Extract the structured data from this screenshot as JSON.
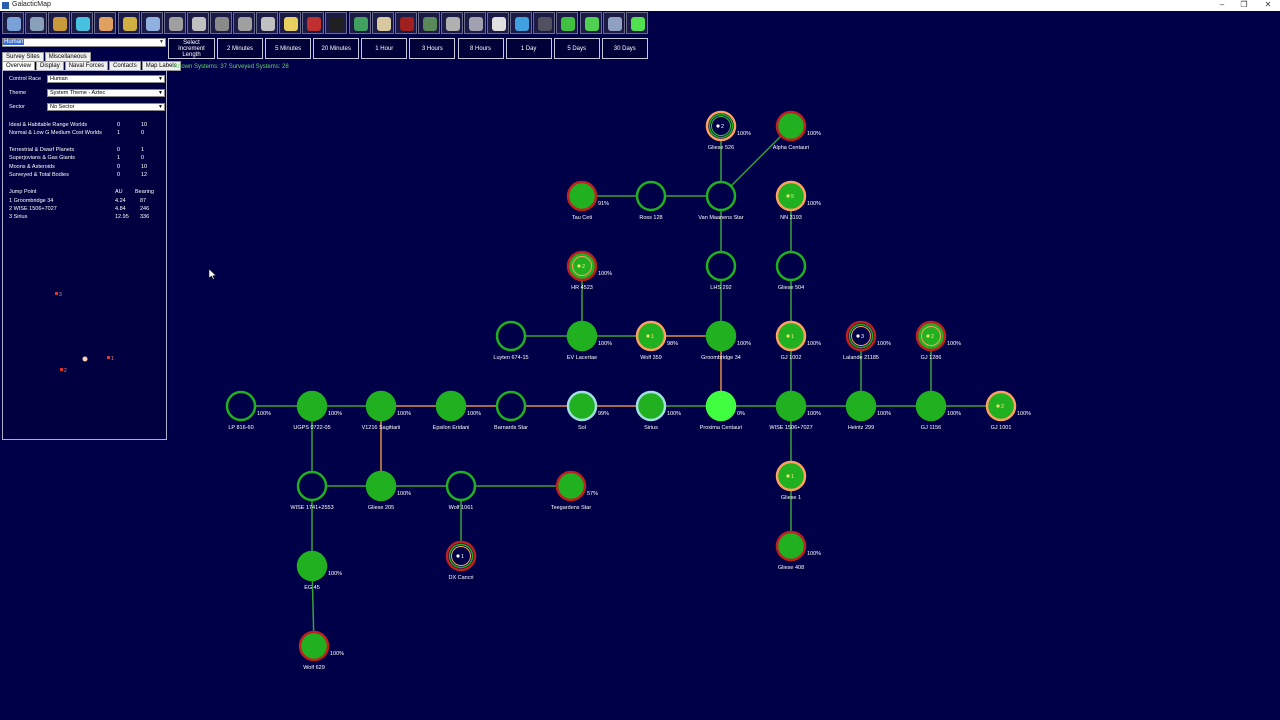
{
  "window": {
    "title": "GalacticMap",
    "minimize": "–",
    "restore": "❐",
    "close": "✕"
  },
  "toolbar": {
    "icons": [
      {
        "name": "galaxy-icon",
        "color": "#7aa0d8"
      },
      {
        "name": "planets-icon",
        "color": "#8aa0b8"
      },
      {
        "name": "treasure-chest-icon",
        "color": "#c89a3a"
      },
      {
        "name": "flask-icon",
        "color": "#48c0e0"
      },
      {
        "name": "people-icon",
        "color": "#e0a060"
      },
      {
        "name": "industry-icon",
        "color": "#d0b040"
      },
      {
        "name": "map-icon",
        "color": "#90b0e0"
      },
      {
        "name": "ship-design-icon",
        "color": "#a0a0a0"
      },
      {
        "name": "missile-icon",
        "color": "#c0c0c0"
      },
      {
        "name": "turret-icon",
        "color": "#8a8a8a"
      },
      {
        "name": "ground-forces-icon",
        "color": "#a0a0a0"
      },
      {
        "name": "commander-icon",
        "color": "#c0c0c0"
      },
      {
        "name": "star-icon",
        "color": "#e8d060"
      },
      {
        "name": "flag-icon",
        "color": "#c03030"
      },
      {
        "name": "system-view-icon",
        "color": "#202020"
      },
      {
        "name": "globe-icon",
        "color": "#40a060"
      },
      {
        "name": "skull-icon",
        "color": "#d8c8a0"
      },
      {
        "name": "alien-icon",
        "color": "#a02020"
      },
      {
        "name": "cards-icon",
        "color": "#5a8a5a"
      },
      {
        "name": "gear-icon",
        "color": "#b0b0b0"
      },
      {
        "name": "cargo-icon",
        "color": "#a0a0b0"
      },
      {
        "name": "calendar-icon",
        "color": "#e0e0e0"
      },
      {
        "name": "refresh-icon",
        "color": "#40a0e0"
      },
      {
        "name": "grid-icon",
        "color": "#505060"
      },
      {
        "name": "green-arrow-icon",
        "color": "#40c040"
      },
      {
        "name": "green-plus-icon",
        "color": "#50d050"
      },
      {
        "name": "profile-icon",
        "color": "#90a0c0"
      },
      {
        "name": "green-orb-icon",
        "color": "#50e050"
      }
    ]
  },
  "race_select": {
    "value": "Human"
  },
  "tabs_row1": [
    "Survey Sites",
    "Miscellaneous"
  ],
  "tabs_row2": [
    "Overview",
    "Display",
    "Naval Forces",
    "Contacts",
    "Map Labels"
  ],
  "overview": {
    "control_race_label": "Control Race",
    "control_race_value": "Human",
    "theme_label": "Theme",
    "theme_value": "System Theme - Aztec",
    "sector_label": "Sector",
    "sector_value": "No Sector",
    "stats": [
      {
        "label": "Ideal & Habitable Range Worlds",
        "a": "0",
        "b": "10"
      },
      {
        "label": "Normal & Low G Medium Cost Worlds",
        "a": "1",
        "b": "0"
      },
      {
        "label": "Terrestrial & Dwarf Planets",
        "a": "0",
        "b": "1"
      },
      {
        "label": "Superjovians & Gas Giants",
        "a": "1",
        "b": "0"
      },
      {
        "label": "Moons & Asteroids",
        "a": "0",
        "b": "10"
      },
      {
        "label": "Surveyed & Total Bodies",
        "a": "0",
        "b": "12"
      }
    ],
    "jump_header": {
      "label": "Jump Point",
      "au": "AU",
      "bearing": "Bearing"
    },
    "jumps": [
      {
        "label": "1  Groombridge 34",
        "au": "4.24",
        "bearing": "87"
      },
      {
        "label": "2  WISE 1506+7027",
        "au": "4.84",
        "bearing": "246"
      },
      {
        "label": "3  Sirius",
        "au": "12.95",
        "bearing": "336"
      }
    ],
    "minimap_labels": [
      "3",
      "1",
      "2"
    ]
  },
  "increments": {
    "header": [
      "Select Increment",
      "Length"
    ],
    "buttons": [
      "2 Minutes",
      "5 Minutes",
      "20 Minutes",
      "1 Hour",
      "3 Hours",
      "8 Hours",
      "1 Day",
      "5 Days",
      "30 Days"
    ]
  },
  "known_systems_text": "Known Systems: 37   Surveyed Systems: 28",
  "map": {
    "systems": [
      {
        "id": "gliese526",
        "name": "Gliese 526",
        "pct": "100%",
        "fill": "#000048",
        "ring": "#ffa060",
        "inner": "#40c040",
        "marker": "2"
      },
      {
        "id": "alphacen",
        "name": "Alpha Centauri",
        "pct": "100%",
        "fill": "#20b020",
        "ring": "#c02020",
        "inner": "",
        "marker": ""
      },
      {
        "id": "tauceti",
        "name": "Tau Ceti",
        "pct": "91%",
        "fill": "#20b020",
        "ring": "#c02020",
        "inner": "",
        "marker": ""
      },
      {
        "id": "ross128",
        "name": "Ross 128",
        "pct": "",
        "fill": "#000048",
        "ring": "#20b020",
        "inner": "",
        "marker": ""
      },
      {
        "id": "vanmaanen",
        "name": "Van Maanens Star",
        "pct": "",
        "fill": "#000048",
        "ring": "#20b020",
        "inner": "",
        "marker": ""
      },
      {
        "id": "nn3193",
        "name": "NN 3193",
        "pct": "100%",
        "fill": "#20b020",
        "ring": "#ffa060",
        "inner": "",
        "marker": "5"
      },
      {
        "id": "hr4523",
        "name": "HR 4523",
        "pct": "100%",
        "fill": "#20b020",
        "ring": "#c02020",
        "inner": "#ffa060",
        "marker": "2"
      },
      {
        "id": "lhs292",
        "name": "LHS 292",
        "pct": "",
        "fill": "#000048",
        "ring": "#20b020",
        "inner": "",
        "marker": ""
      },
      {
        "id": "gliese504",
        "name": "Gliese 504",
        "pct": "",
        "fill": "#000048",
        "ring": "#20b020",
        "inner": "",
        "marker": ""
      },
      {
        "id": "luyten",
        "name": "Luyten 674-15",
        "pct": "",
        "fill": "#000048",
        "ring": "#20b020",
        "inner": "",
        "marker": ""
      },
      {
        "id": "evlac",
        "name": "EV Lacertae",
        "pct": "100%",
        "fill": "#20b020",
        "ring": "#20b020",
        "inner": "",
        "marker": ""
      },
      {
        "id": "wolf359",
        "name": "Wolf 359",
        "pct": "98%",
        "fill": "#20b020",
        "ring": "#ffa060",
        "inner": "",
        "marker": "1"
      },
      {
        "id": "groom34",
        "name": "Groombridge 34",
        "pct": "100%",
        "fill": "#20b020",
        "ring": "#20b020",
        "inner": "",
        "marker": ""
      },
      {
        "id": "gj1002",
        "name": "GJ 1002",
        "pct": "100%",
        "fill": "#20b020",
        "ring": "#ffa060",
        "inner": "",
        "marker": "1"
      },
      {
        "id": "lalande",
        "name": "Lalande 21185",
        "pct": "100%",
        "fill": "#000048",
        "ring": "#c02020",
        "inner": "#ffa060",
        "marker": "3"
      },
      {
        "id": "gj1286",
        "name": "GJ 1286",
        "pct": "100%",
        "fill": "#20b020",
        "ring": "#c02020",
        "inner": "#ffa060",
        "marker": "2"
      },
      {
        "id": "lp816",
        "name": "LP 816-60",
        "pct": "100%",
        "fill": "#000048",
        "ring": "#20b020",
        "inner": "",
        "marker": ""
      },
      {
        "id": "ugps",
        "name": "UGPS 0722-05",
        "pct": "100%",
        "fill": "#20b020",
        "ring": "#20b020",
        "inner": "",
        "marker": ""
      },
      {
        "id": "v1216",
        "name": "V1216 Sagittarii",
        "pct": "100%",
        "fill": "#20b020",
        "ring": "#20b020",
        "inner": "",
        "marker": ""
      },
      {
        "id": "epseri",
        "name": "Epsilon Eridani",
        "pct": "100%",
        "fill": "#20b020",
        "ring": "#20b020",
        "inner": "",
        "marker": ""
      },
      {
        "id": "barnard",
        "name": "Barnards Star",
        "pct": "",
        "fill": "#000048",
        "ring": "#20b020",
        "inner": "",
        "marker": ""
      },
      {
        "id": "sol",
        "name": "Sol",
        "pct": "99%",
        "fill": "#20b020",
        "ring": "#a0e0e0",
        "inner": "",
        "marker": ""
      },
      {
        "id": "sirius",
        "name": "Sirius",
        "pct": "100%",
        "fill": "#20b020",
        "ring": "#a0e0e0",
        "inner": "",
        "marker": ""
      },
      {
        "id": "proxima",
        "name": "Proxima Centauri",
        "pct": "0%",
        "fill": "#40ff40",
        "ring": "#40ff40",
        "inner": "",
        "marker": ""
      },
      {
        "id": "wise1506",
        "name": "WISE 1506+7027",
        "pct": "100%",
        "fill": "#20b020",
        "ring": "#20b020",
        "inner": "",
        "marker": ""
      },
      {
        "id": "heintz",
        "name": "Heintz 299",
        "pct": "100%",
        "fill": "#20b020",
        "ring": "#20b020",
        "inner": "",
        "marker": ""
      },
      {
        "id": "gj1156",
        "name": "GJ 1156",
        "pct": "100%",
        "fill": "#20b020",
        "ring": "#20b020",
        "inner": "",
        "marker": ""
      },
      {
        "id": "gj1001",
        "name": "GJ 1001",
        "pct": "100%",
        "fill": "#20b020",
        "ring": "#ffa060",
        "inner": "",
        "marker": "2"
      },
      {
        "id": "wise1741",
        "name": "WISE 1741+2553",
        "pct": "",
        "fill": "#000048",
        "ring": "#20b020",
        "inner": "",
        "marker": ""
      },
      {
        "id": "gliese205",
        "name": "Gliese 205",
        "pct": "100%",
        "fill": "#20b020",
        "ring": "#20b020",
        "inner": "",
        "marker": ""
      },
      {
        "id": "wolf1061",
        "name": "Wolf 1061",
        "pct": "",
        "fill": "#000048",
        "ring": "#20b020",
        "inner": "",
        "marker": ""
      },
      {
        "id": "teegarden",
        "name": "Teegardens Star",
        "pct": "57%",
        "fill": "#20b020",
        "ring": "#c02020",
        "inner": "",
        "marker": ""
      },
      {
        "id": "gliese1",
        "name": "Gliese 1",
        "pct": "",
        "fill": "#20b020",
        "ring": "#ffa060",
        "inner": "",
        "marker": "1"
      },
      {
        "id": "dxcancri",
        "name": "DX Cancri",
        "pct": "",
        "fill": "#000048",
        "ring": "#c02020",
        "inner": "#ffa060",
        "marker": "1"
      },
      {
        "id": "gliese408",
        "name": "Gliese 408",
        "pct": "100%",
        "fill": "#20b020",
        "ring": "#c02020",
        "inner": "",
        "marker": ""
      },
      {
        "id": "eg45",
        "name": "EG 45",
        "pct": "100%",
        "fill": "#20b020",
        "ring": "#20b020",
        "inner": "",
        "marker": ""
      },
      {
        "id": "wolf629",
        "name": "Wolf 629",
        "pct": "100%",
        "fill": "#20b020",
        "ring": "#c02020",
        "inner": "",
        "marker": ""
      }
    ]
  }
}
